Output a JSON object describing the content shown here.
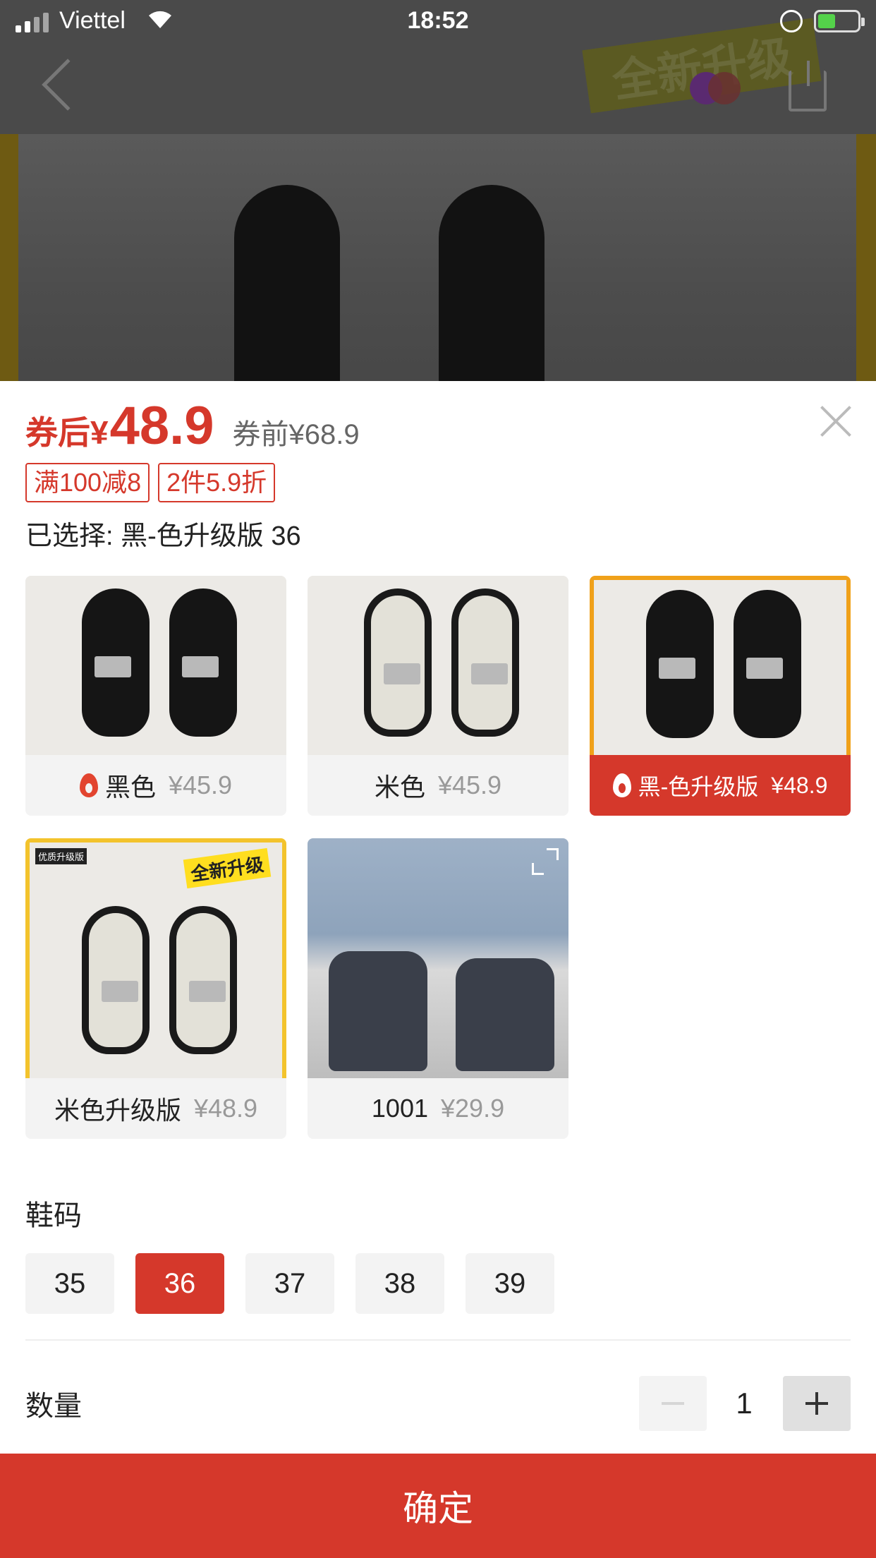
{
  "status_bar": {
    "carrier": "Viettel",
    "time": "18:52"
  },
  "background": {
    "badge_text": "全新升级"
  },
  "header": {
    "price_prefix": "券后¥",
    "price_after": "48.9",
    "price_before": "券前¥68.9"
  },
  "promos": [
    "满100减8",
    "2件5.9折"
  ],
  "selection_text": "已选择: 黑-色升级版 36",
  "variants": [
    {
      "name": "黑色",
      "price": "¥45.9",
      "hot": true,
      "selected": false
    },
    {
      "name": "米色",
      "price": "¥45.9",
      "hot": false,
      "selected": false
    },
    {
      "name": "黑-色升级版",
      "price": "¥48.9",
      "hot": true,
      "selected": true
    },
    {
      "name": "米色升级版",
      "price": "¥48.9",
      "hot": false,
      "selected": false
    },
    {
      "name": "1001",
      "price": "¥29.9",
      "hot": false,
      "selected": false
    }
  ],
  "variant_badges": {
    "upgrade_small": "优质升级版",
    "upgrade_sticker": "全新升级"
  },
  "size": {
    "title": "鞋码",
    "options": [
      "35",
      "36",
      "37",
      "38",
      "39"
    ],
    "selected": "36"
  },
  "quantity": {
    "title": "数量",
    "value": "1"
  },
  "confirm_label": "确定",
  "colors": {
    "accent": "#d5382b",
    "chip_bg": "#f3f3f3"
  }
}
